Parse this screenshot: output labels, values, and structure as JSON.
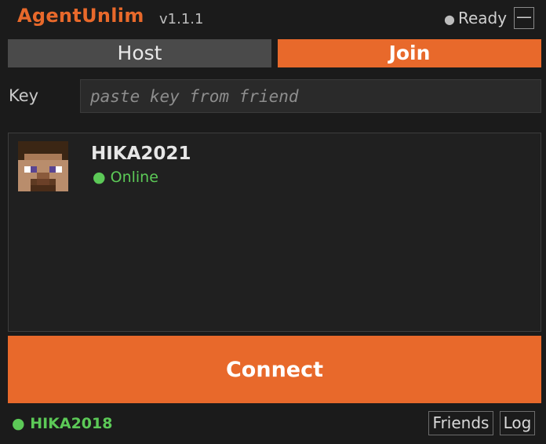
{
  "app": {
    "title": "AgentUnlim",
    "version": "v1.1.1"
  },
  "status": {
    "dot": "●",
    "text": "Ready"
  },
  "window": {
    "minimize_label": "—"
  },
  "tabs": [
    {
      "label": "Host",
      "active": false
    },
    {
      "label": "Join",
      "active": true
    }
  ],
  "key_field": {
    "label": "Key",
    "value": "",
    "placeholder": "paste key from friend"
  },
  "friends": [
    {
      "name": "HIKA2021",
      "status": "● Online",
      "avatar": "player-head-avatar"
    }
  ],
  "connect": {
    "label": "Connect"
  },
  "footer": {
    "current_user": "● HIKA2018",
    "friends_label": "Friends",
    "log_label": "Log"
  },
  "colors": {
    "accent": "#e8692b",
    "online": "#5cc957",
    "background": "#1b1b1b",
    "panel": "#202020",
    "tab_inactive": "#4a4a4a"
  }
}
